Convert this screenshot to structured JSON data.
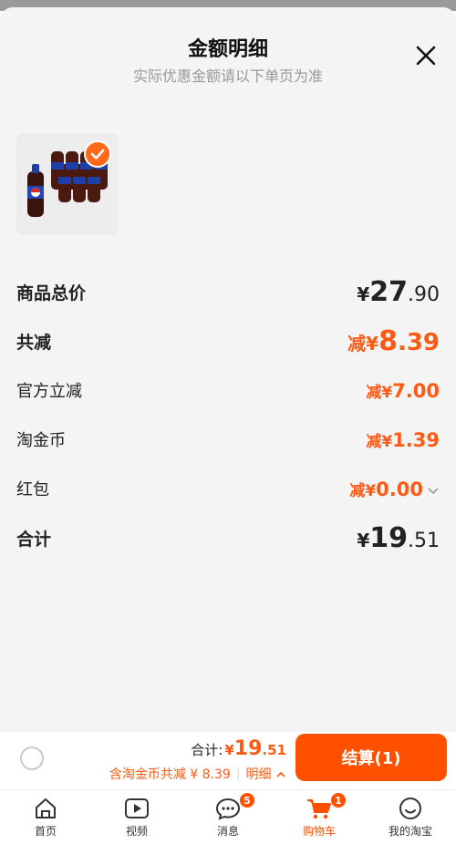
{
  "sheet": {
    "title": "金额明细",
    "subtitle": "实际优惠金额请以下单页为准",
    "close_icon": "close-icon"
  },
  "rows": [
    {
      "label": "商品总价",
      "pre": "¥",
      "int": "27",
      "dec": ".90"
    },
    {
      "label": "共减",
      "pre": "减¥",
      "int": "8",
      "dec": ".39"
    },
    {
      "label": "官方立减",
      "pre": "减¥",
      "int": "7",
      "dec": ".00"
    },
    {
      "label": "淘金币",
      "pre": "减¥",
      "int": "1",
      "dec": ".39"
    },
    {
      "label": "红包",
      "pre": "减¥",
      "int": "0",
      "dec": ".00"
    },
    {
      "label": "合计",
      "pre": "¥",
      "int": "19",
      "dec": ".51"
    }
  ],
  "checkout": {
    "total_label": "合计:",
    "total_symbol": "¥",
    "total_int": "19",
    "total_dec": ".51",
    "discount_note": "含淘金币共减 ¥ 8.39",
    "detail_label": "明细",
    "pay_label": "结算(1)"
  },
  "tabs": [
    {
      "label": "首页",
      "icon": "home-icon",
      "badge": ""
    },
    {
      "label": "视频",
      "icon": "video-icon",
      "badge": ""
    },
    {
      "label": "消息",
      "icon": "message-icon",
      "badge": "5"
    },
    {
      "label": "购物车",
      "icon": "cart-icon",
      "badge": "1"
    },
    {
      "label": "我的淘宝",
      "icon": "profile-icon",
      "badge": ""
    }
  ],
  "colors": {
    "accent": "#ff5000",
    "discount": "#ff5a14"
  }
}
